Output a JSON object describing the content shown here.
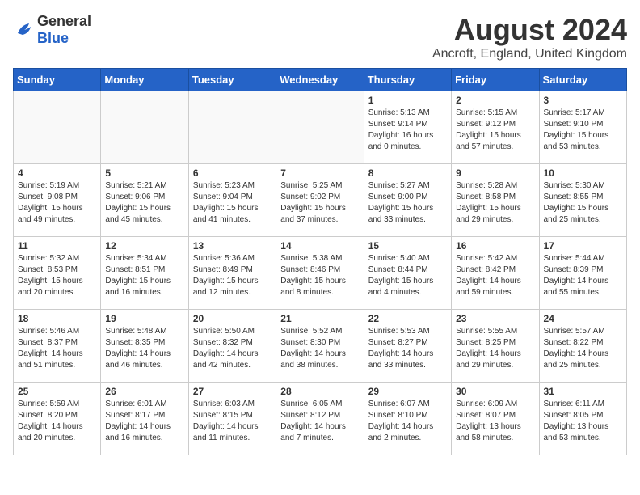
{
  "header": {
    "logo_general": "General",
    "logo_blue": "Blue",
    "month_year": "August 2024",
    "location": "Ancroft, England, United Kingdom"
  },
  "weekdays": [
    "Sunday",
    "Monday",
    "Tuesday",
    "Wednesday",
    "Thursday",
    "Friday",
    "Saturday"
  ],
  "weeks": [
    [
      {
        "day": "",
        "empty": true
      },
      {
        "day": "",
        "empty": true
      },
      {
        "day": "",
        "empty": true
      },
      {
        "day": "",
        "empty": true
      },
      {
        "day": "1",
        "info": "Sunrise: 5:13 AM\nSunset: 9:14 PM\nDaylight: 16 hours\nand 0 minutes."
      },
      {
        "day": "2",
        "info": "Sunrise: 5:15 AM\nSunset: 9:12 PM\nDaylight: 15 hours\nand 57 minutes."
      },
      {
        "day": "3",
        "info": "Sunrise: 5:17 AM\nSunset: 9:10 PM\nDaylight: 15 hours\nand 53 minutes."
      }
    ],
    [
      {
        "day": "4",
        "info": "Sunrise: 5:19 AM\nSunset: 9:08 PM\nDaylight: 15 hours\nand 49 minutes."
      },
      {
        "day": "5",
        "info": "Sunrise: 5:21 AM\nSunset: 9:06 PM\nDaylight: 15 hours\nand 45 minutes."
      },
      {
        "day": "6",
        "info": "Sunrise: 5:23 AM\nSunset: 9:04 PM\nDaylight: 15 hours\nand 41 minutes."
      },
      {
        "day": "7",
        "info": "Sunrise: 5:25 AM\nSunset: 9:02 PM\nDaylight: 15 hours\nand 37 minutes."
      },
      {
        "day": "8",
        "info": "Sunrise: 5:27 AM\nSunset: 9:00 PM\nDaylight: 15 hours\nand 33 minutes."
      },
      {
        "day": "9",
        "info": "Sunrise: 5:28 AM\nSunset: 8:58 PM\nDaylight: 15 hours\nand 29 minutes."
      },
      {
        "day": "10",
        "info": "Sunrise: 5:30 AM\nSunset: 8:55 PM\nDaylight: 15 hours\nand 25 minutes."
      }
    ],
    [
      {
        "day": "11",
        "info": "Sunrise: 5:32 AM\nSunset: 8:53 PM\nDaylight: 15 hours\nand 20 minutes."
      },
      {
        "day": "12",
        "info": "Sunrise: 5:34 AM\nSunset: 8:51 PM\nDaylight: 15 hours\nand 16 minutes."
      },
      {
        "day": "13",
        "info": "Sunrise: 5:36 AM\nSunset: 8:49 PM\nDaylight: 15 hours\nand 12 minutes."
      },
      {
        "day": "14",
        "info": "Sunrise: 5:38 AM\nSunset: 8:46 PM\nDaylight: 15 hours\nand 8 minutes."
      },
      {
        "day": "15",
        "info": "Sunrise: 5:40 AM\nSunset: 8:44 PM\nDaylight: 15 hours\nand 4 minutes."
      },
      {
        "day": "16",
        "info": "Sunrise: 5:42 AM\nSunset: 8:42 PM\nDaylight: 14 hours\nand 59 minutes."
      },
      {
        "day": "17",
        "info": "Sunrise: 5:44 AM\nSunset: 8:39 PM\nDaylight: 14 hours\nand 55 minutes."
      }
    ],
    [
      {
        "day": "18",
        "info": "Sunrise: 5:46 AM\nSunset: 8:37 PM\nDaylight: 14 hours\nand 51 minutes."
      },
      {
        "day": "19",
        "info": "Sunrise: 5:48 AM\nSunset: 8:35 PM\nDaylight: 14 hours\nand 46 minutes."
      },
      {
        "day": "20",
        "info": "Sunrise: 5:50 AM\nSunset: 8:32 PM\nDaylight: 14 hours\nand 42 minutes."
      },
      {
        "day": "21",
        "info": "Sunrise: 5:52 AM\nSunset: 8:30 PM\nDaylight: 14 hours\nand 38 minutes."
      },
      {
        "day": "22",
        "info": "Sunrise: 5:53 AM\nSunset: 8:27 PM\nDaylight: 14 hours\nand 33 minutes."
      },
      {
        "day": "23",
        "info": "Sunrise: 5:55 AM\nSunset: 8:25 PM\nDaylight: 14 hours\nand 29 minutes."
      },
      {
        "day": "24",
        "info": "Sunrise: 5:57 AM\nSunset: 8:22 PM\nDaylight: 14 hours\nand 25 minutes."
      }
    ],
    [
      {
        "day": "25",
        "info": "Sunrise: 5:59 AM\nSunset: 8:20 PM\nDaylight: 14 hours\nand 20 minutes."
      },
      {
        "day": "26",
        "info": "Sunrise: 6:01 AM\nSunset: 8:17 PM\nDaylight: 14 hours\nand 16 minutes."
      },
      {
        "day": "27",
        "info": "Sunrise: 6:03 AM\nSunset: 8:15 PM\nDaylight: 14 hours\nand 11 minutes."
      },
      {
        "day": "28",
        "info": "Sunrise: 6:05 AM\nSunset: 8:12 PM\nDaylight: 14 hours\nand 7 minutes."
      },
      {
        "day": "29",
        "info": "Sunrise: 6:07 AM\nSunset: 8:10 PM\nDaylight: 14 hours\nand 2 minutes."
      },
      {
        "day": "30",
        "info": "Sunrise: 6:09 AM\nSunset: 8:07 PM\nDaylight: 13 hours\nand 58 minutes."
      },
      {
        "day": "31",
        "info": "Sunrise: 6:11 AM\nSunset: 8:05 PM\nDaylight: 13 hours\nand 53 minutes."
      }
    ]
  ]
}
